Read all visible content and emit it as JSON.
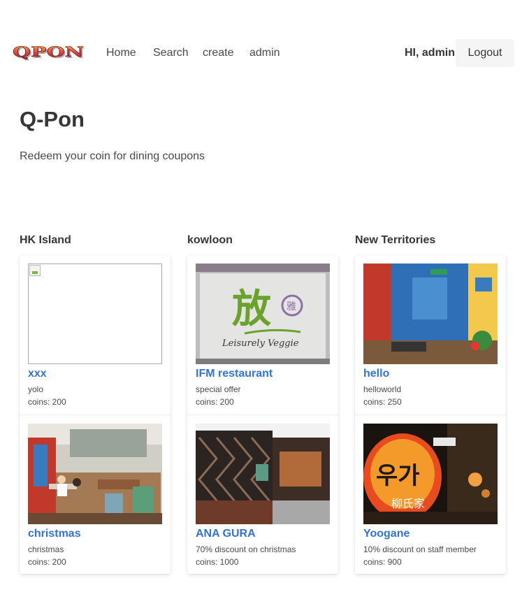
{
  "brand": {
    "logo_text": "QPON"
  },
  "nav": {
    "items": [
      {
        "label": "Home"
      },
      {
        "label": "Search"
      },
      {
        "label": "create"
      },
      {
        "label": "admin"
      }
    ],
    "greeting": "HI, admin",
    "logout_label": "Logout"
  },
  "hero": {
    "title": "Q-Pon",
    "subtitle": "Redeem your coin for dining coupons"
  },
  "columns": [
    {
      "heading": "HK Island",
      "cards": [
        {
          "title": "xxx",
          "description": "yolo",
          "coins": "coins: 200",
          "image": "broken-image-icon"
        },
        {
          "title": "christmas",
          "description": "christmas",
          "coins": "coins: 200",
          "image": "restaurant-interior-photo"
        }
      ]
    },
    {
      "heading": "kowloon",
      "cards": [
        {
          "title": "IFM restaurant",
          "description": "special offer",
          "coins": "coins: 200",
          "image": "leisurely-veggie-sign-photo",
          "image_text": "Leisurely Veggie"
        },
        {
          "title": "ANA GURA",
          "description": "70% discount on christmas",
          "coins": "coins: 1000",
          "image": "restaurant-entrance-photo"
        }
      ]
    },
    {
      "heading": "New Territories",
      "cards": [
        {
          "title": "hello",
          "description": "helloworld",
          "coins": "coins: 250",
          "image": "colorful-cafe-photo"
        },
        {
          "title": "Yoogane",
          "description": "10% discount on staff member",
          "coins": "coins: 900",
          "image": "yoogane-sign-photo"
        }
      ]
    }
  ],
  "colors": {
    "link": "#3273dc",
    "text": "#363636",
    "logout_bg": "#f5f5f5",
    "logo_red": "#c0392b",
    "logo_gold": "#e0a020"
  }
}
